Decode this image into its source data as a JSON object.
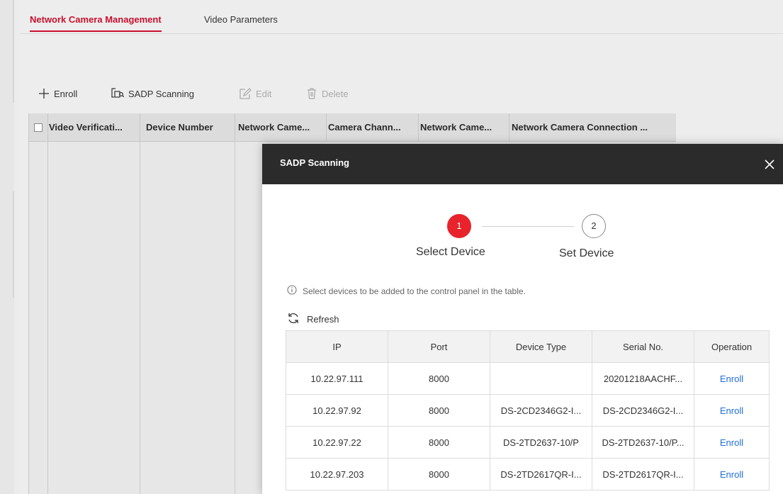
{
  "tabs": [
    {
      "label": "Network Camera Management"
    },
    {
      "label": "Video Parameters"
    }
  ],
  "toolbar": {
    "enroll": "Enroll",
    "sadp": "SADP Scanning",
    "edit": "Edit",
    "delete": "Delete"
  },
  "grid": {
    "headers": [
      "Video Verificati...",
      "Device Number",
      "Network Came...",
      "Camera Chann...",
      "Network Came...",
      "Network Camera Connection ..."
    ]
  },
  "dialog": {
    "title": "SADP Scanning",
    "steps": [
      {
        "num": "1",
        "label": "Select Device"
      },
      {
        "num": "2",
        "label": "Set Device"
      }
    ],
    "hint": "Select devices to be added to the control panel in the table.",
    "refresh": "Refresh",
    "columns": [
      "IP",
      "Port",
      "Device Type",
      "Serial No.",
      "Operation"
    ],
    "rows": [
      {
        "ip": "10.22.97.111",
        "port": "8000",
        "device_type": "",
        "serial": "20201218AACHF...",
        "op": "Enroll"
      },
      {
        "ip": "10.22.97.92",
        "port": "8000",
        "device_type": "DS-2CD2346G2-I...",
        "serial": "DS-2CD2346G2-I...",
        "op": "Enroll"
      },
      {
        "ip": "10.22.97.22",
        "port": "8000",
        "device_type": "DS-2TD2637-10/P",
        "serial": "DS-2TD2637-10/P...",
        "op": "Enroll"
      },
      {
        "ip": "10.22.97.203",
        "port": "8000",
        "device_type": "DS-2TD2617QR-I...",
        "serial": "DS-2TD2617QR-I...",
        "op": "Enroll"
      }
    ]
  },
  "colors": {
    "accent": "#c8102e",
    "step_active": "#e8232b",
    "link": "#1e6fd9",
    "dialog_header": "#2b2b2b"
  }
}
